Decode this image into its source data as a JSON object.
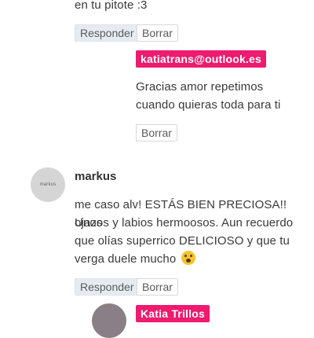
{
  "top_comment": {
    "text_tail": "en tu pitote :3"
  },
  "actions": {
    "reply_label": "Responder",
    "delete_label": "Borrar"
  },
  "reply_1": {
    "author": "katiatrans@outlook.es",
    "lines": [
      "Gracias amor repetimos",
      "cuando quieras toda para ti"
    ]
  },
  "comment_markus": {
    "author": "markus",
    "avatar_text": "markus",
    "lines": [
      "me caso alv! ESTÁS BIEN PRECIOSA!! Unos",
      "ojazos y labios hermoosos. Aun recuerdo",
      "que olías superrico DELICIOSO y que tu",
      "verga duele mucho"
    ],
    "emoji": "drooling-face-icon"
  },
  "reply_2": {
    "author": "Katia Trillos"
  },
  "colors": {
    "badge": "#ee1b6f",
    "reply_bg": "#e6ebf1"
  }
}
